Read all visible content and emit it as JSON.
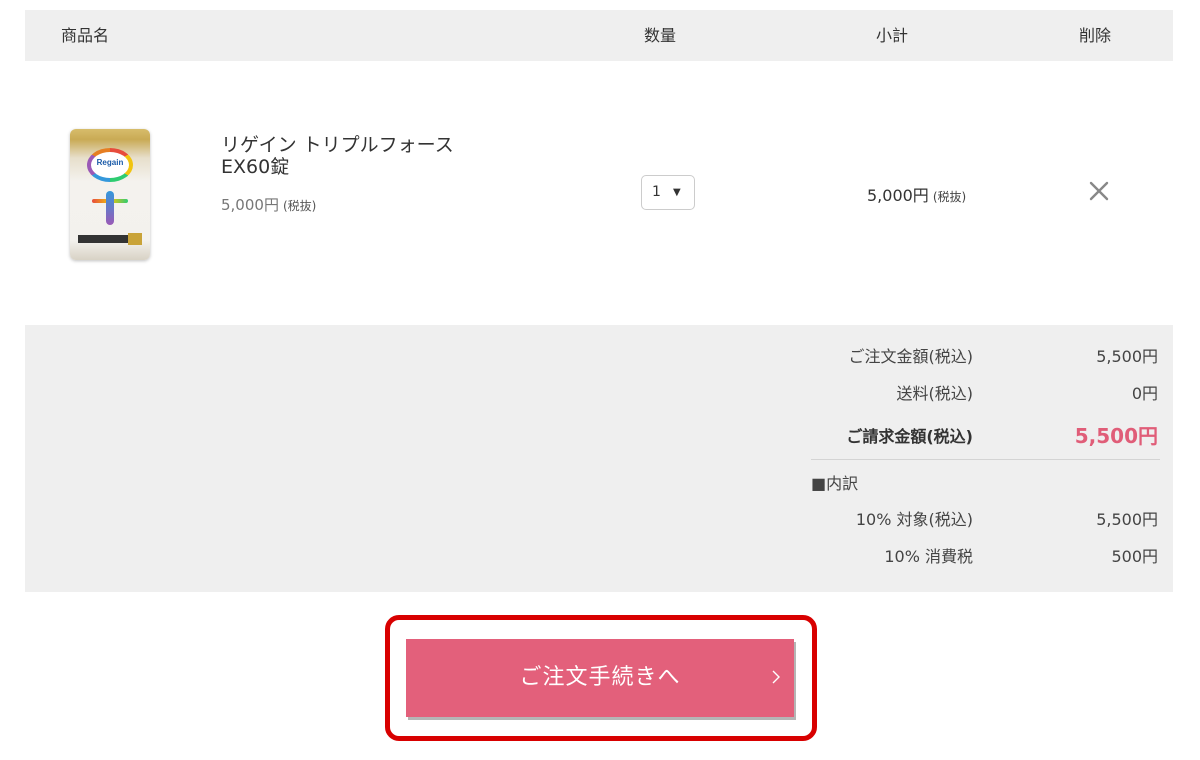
{
  "header": {
    "product_name": "商品名",
    "quantity": "数量",
    "subtotal": "小計",
    "delete": "削除"
  },
  "item": {
    "name_line1": "リゲイン トリプルフォース",
    "name_line2": "EX60錠",
    "price": "5,000円",
    "price_note": "(税抜)",
    "quantity": "1",
    "quantity_arrow": "▼",
    "subtotal": "5,000円",
    "subtotal_note": "(税抜)",
    "image_logo_text": "Regain"
  },
  "totals": {
    "order_amount_label": "ご注文金額(税込)",
    "order_amount_value": "5,500円",
    "shipping_label": "送料(税込)",
    "shipping_value": "0円",
    "grand_total_label": "ご請求金額(税込)",
    "grand_total_value": "5,500円",
    "breakdown_label": "■内訳",
    "taxable_label": "10% 対象(税込)",
    "taxable_value": "5,500円",
    "tax_label": "10% 消費税",
    "tax_value": "500円"
  },
  "checkout": {
    "label": "ご注文手続きへ"
  },
  "colors": {
    "accent": "#e3607b",
    "grand_total": "#e05d78",
    "highlight": "#d80000",
    "panel_bg": "#efefef"
  },
  "icons": {
    "delete": "close-icon",
    "next": "chevron-right-icon"
  }
}
